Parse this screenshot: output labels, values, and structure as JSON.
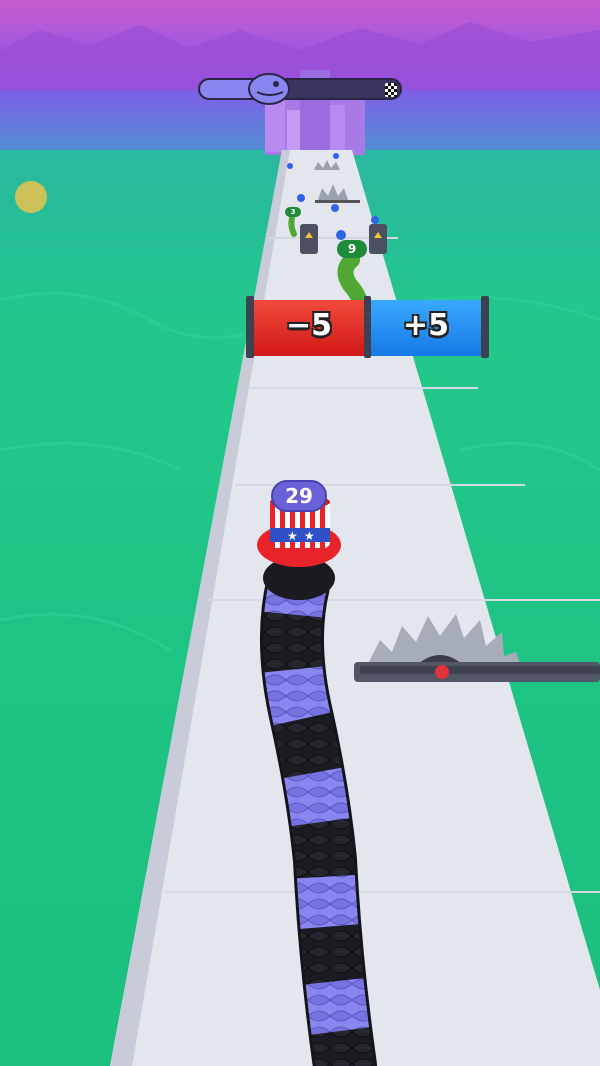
{
  "progress": {
    "value": 0.35
  },
  "gates": {
    "left_label": "−5",
    "right_label": "+5",
    "left_color": "#e5262b",
    "right_color": "#1f8ff0"
  },
  "player": {
    "count": "29",
    "color": "#8a86f0"
  },
  "enemy": {
    "count": "9",
    "far_count": "3"
  },
  "colors": {
    "sky_top": "#c55fd6",
    "sky_bottom": "#6a4ff0",
    "sea": "#1fc483",
    "road": "#e6e8ef"
  }
}
